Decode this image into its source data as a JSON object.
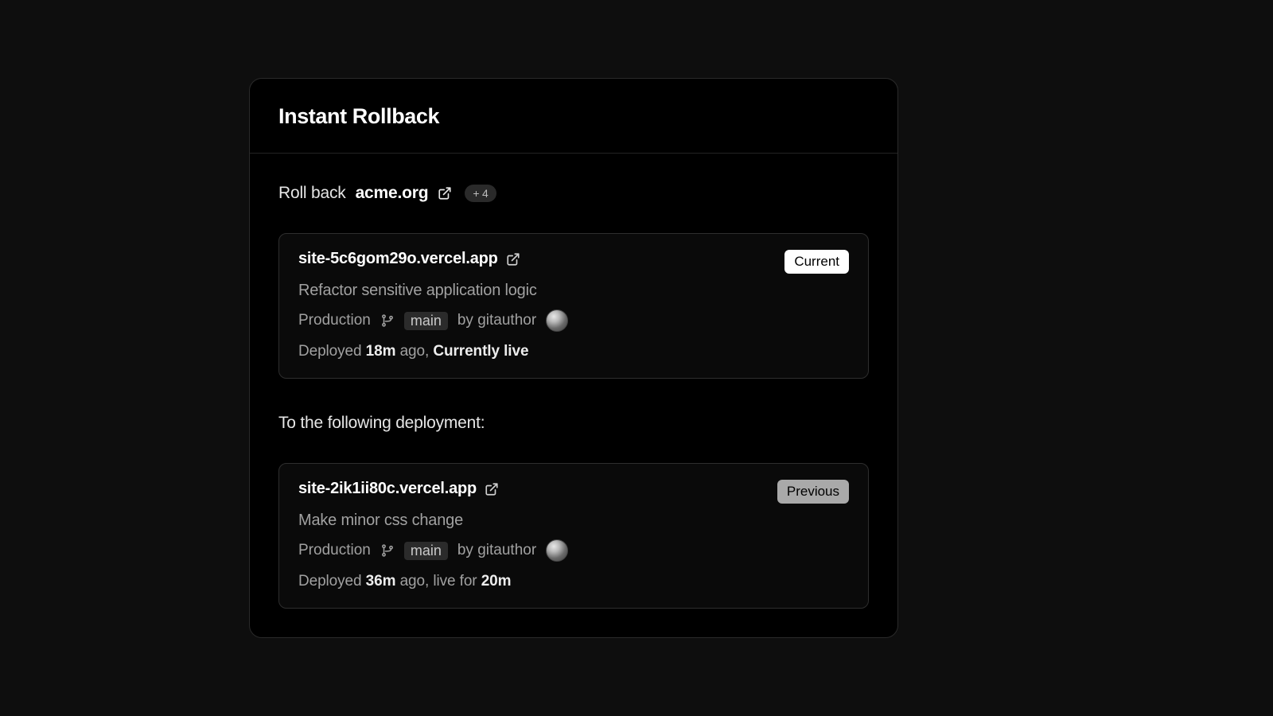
{
  "header": {
    "title": "Instant Rollback"
  },
  "rollback": {
    "prefix": "Roll back",
    "domain": "acme.org",
    "extra_count": "+ 4"
  },
  "current": {
    "url": "site-5c6gom29o.vercel.app",
    "status": "Current",
    "message": "Refactor sensitive application logic",
    "env": "Production",
    "branch": "main",
    "author_prefix": "by",
    "author": "gitauthor",
    "deployed_prefix": "Deployed",
    "deployed_age": "18m",
    "deployed_suffix": "ago,",
    "live_label": "Currently live"
  },
  "section_label": "To the following deployment:",
  "previous": {
    "url": "site-2ik1ii80c.vercel.app",
    "status": "Previous",
    "message": "Make minor css change",
    "env": "Production",
    "branch": "main",
    "author_prefix": "by",
    "author": "gitauthor",
    "deployed_prefix": "Deployed",
    "deployed_age": "36m",
    "deployed_mid": "ago, live for",
    "live_duration": "20m"
  }
}
